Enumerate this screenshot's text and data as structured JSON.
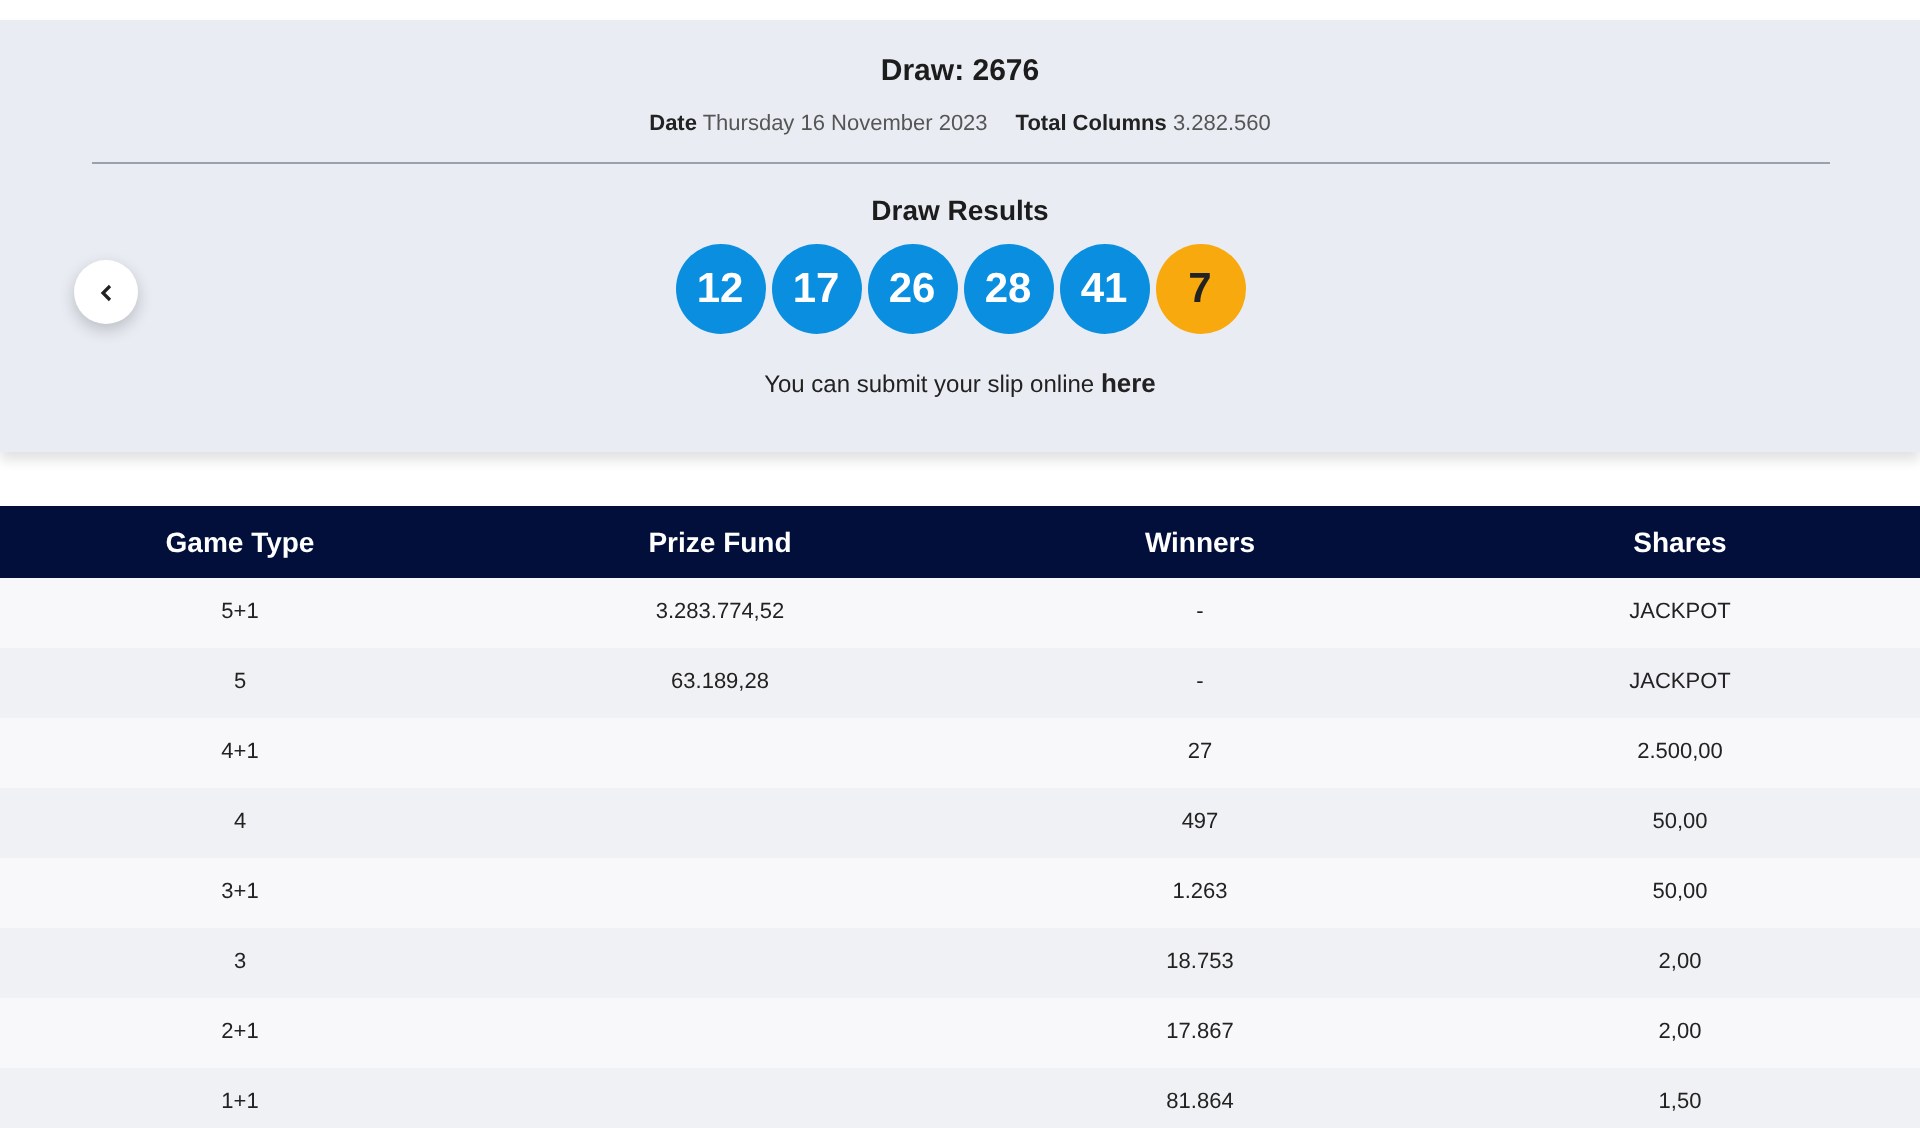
{
  "draw": {
    "title": "Draw: 2676",
    "date_label": "Date",
    "date": "Thursday 16 November 2023",
    "columns_label": "Total Columns",
    "columns": "3.282.560"
  },
  "results": {
    "title": "Draw Results",
    "balls": [
      {
        "number": "12",
        "kind": "main"
      },
      {
        "number": "17",
        "kind": "main"
      },
      {
        "number": "26",
        "kind": "main"
      },
      {
        "number": "28",
        "kind": "main"
      },
      {
        "number": "41",
        "kind": "main"
      },
      {
        "number": "7",
        "kind": "bonus"
      }
    ],
    "submit_text": "You can submit your slip online",
    "submit_link": "here"
  },
  "table": {
    "columns": [
      "Game Type",
      "Prize Fund",
      "Winners",
      "Shares"
    ],
    "rows": [
      {
        "game_type": "5+1",
        "prize_fund": "3.283.774,52",
        "winners": "-",
        "shares": "JACKPOT"
      },
      {
        "game_type": "5",
        "prize_fund": "63.189,28",
        "winners": "-",
        "shares": "JACKPOT"
      },
      {
        "game_type": "4+1",
        "winners": "27",
        "shares": "2.500,00"
      },
      {
        "game_type": "4",
        "winners": "497",
        "shares": "50,00"
      },
      {
        "game_type": "3+1",
        "winners": "1.263",
        "shares": "50,00"
      },
      {
        "game_type": "3",
        "winners": "18.753",
        "shares": "2,00"
      },
      {
        "game_type": "2+1",
        "winners": "17.867",
        "shares": "2,00"
      },
      {
        "game_type": "1+1",
        "winners": "81.864",
        "shares": "1,50"
      }
    ]
  }
}
